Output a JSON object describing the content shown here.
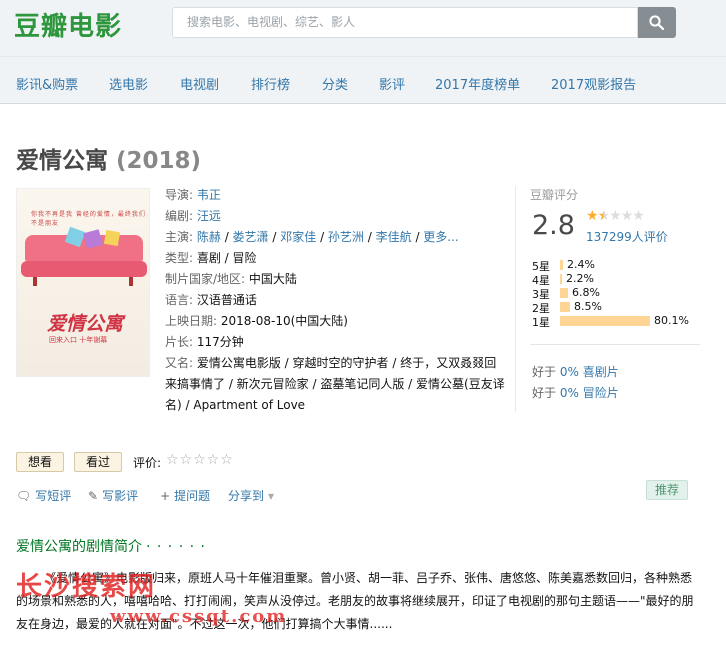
{
  "header": {
    "logo": "豆瓣电影",
    "search_placeholder": "搜索电影、电视剧、综艺、影人"
  },
  "nav": [
    "影讯&购票",
    "选电影",
    "电视剧",
    "排行榜",
    "分类",
    "影评",
    "2017年度榜单",
    "2017观影报告"
  ],
  "movie": {
    "title": "爱情公寓",
    "year": "(2018)",
    "info": {
      "director_label": "导演: ",
      "director": "韦正",
      "writer_label": "编剧: ",
      "writer": "汪远",
      "cast_label": "主演: ",
      "cast": [
        "陈赫",
        "娄艺潇",
        "邓家佳",
        "孙艺洲",
        "李佳航"
      ],
      "cast_sep": " / ",
      "cast_more": "更多...",
      "genre_label": "类型: ",
      "genre": "喜剧 / 冒险",
      "country_label": "制片国家/地区: ",
      "country": "中国大陆",
      "language_label": "语言: ",
      "language": "汉语普通话",
      "release_label": "上映日期: ",
      "release": "2018-08-10(中国大陆)",
      "runtime_label": "片长: ",
      "runtime": "117分钟",
      "aka_label": "又名: ",
      "aka": "爱情公寓电影版 / 穿越时空的守护者 / 终于，又双叒叕回来搞事情了 / 新次元冒险家 / 盗墓笔记同人版 / 爱情公墓(豆友译名) / Apartment of Love"
    }
  },
  "poster": {
    "tagline": "你我不再是我 曾经的爱情，最终我们不是朋友",
    "title": "爱情公寓",
    "subtitle": "回来入口 十年谢幕"
  },
  "rating": {
    "label": "豆瓣评分",
    "score": "2.8",
    "stars_value": 1.5,
    "votes": "137299人评价",
    "distribution": [
      {
        "label": "5星",
        "pct": "2.4%",
        "value": 2.4
      },
      {
        "label": "4星",
        "pct": "2.2%",
        "value": 2.2
      },
      {
        "label": "3星",
        "pct": "6.8%",
        "value": 6.8
      },
      {
        "label": "2星",
        "pct": "8.5%",
        "value": 8.5
      },
      {
        "label": "1星",
        "pct": "80.1%",
        "value": 80.1
      }
    ],
    "better_than": [
      {
        "prefix": "好于 ",
        "pct": "0%",
        "genre": "喜剧片"
      },
      {
        "prefix": "好于 ",
        "pct": "0%",
        "genre": "冒险片"
      }
    ]
  },
  "actions": {
    "want": "想看",
    "seen": "看过",
    "rate_label": "评价:",
    "rate_stars": "☆☆☆☆☆",
    "write_short": "写短评",
    "write_review": "写影评",
    "ask": "提问题",
    "share": "分享到",
    "recommend": "推荐"
  },
  "synopsis": {
    "title": "爱情公寓的剧情简介",
    "dots": "· · · · · ·",
    "text": "《爱情公寓》电影版归来，原班人马十年催泪重聚。曾小贤、胡一菲、吕子乔、张伟、唐悠悠、陈美嘉悉数回归，各种熟悉的场景和熟悉的人，嘻嘻哈哈、打打闹闹，笑声从没停过。老朋友的故事将继续展开，印证了电视剧的那句主题语——\"最好的朋友在身边，最爱的人就在对面\"。不过这一次，他们打算搞个大事情......"
  },
  "watermark": {
    "main": "长沙搜索网",
    "url": "www.cssqt.com"
  },
  "colors": {
    "brand": "#2e963d",
    "link": "#3377aa",
    "star": "#ffac2d",
    "bar": "#ffd596",
    "section": "#007722",
    "watermark": "#e11e1e"
  }
}
